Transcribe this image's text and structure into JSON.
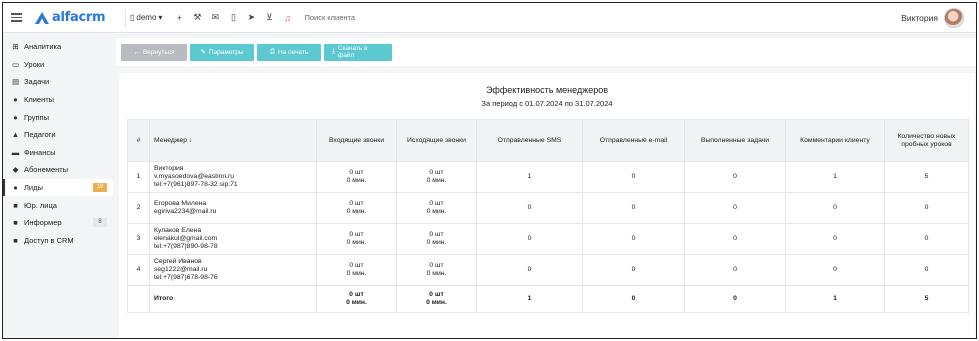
{
  "topbar": {
    "logo_text": "alfacrm",
    "demo_label": "demo",
    "search_placeholder": "Поиск клиента",
    "user_name": "Виктория"
  },
  "sidebar": {
    "items": [
      {
        "label": "Аналитика",
        "icon": "analytics-icon",
        "glyph": "⊞"
      },
      {
        "label": "Уроки",
        "icon": "calendar-icon",
        "glyph": "▭"
      },
      {
        "label": "Задачи",
        "icon": "tasks-icon",
        "glyph": "▤"
      },
      {
        "label": "Клиенты",
        "icon": "user-icon",
        "glyph": "●"
      },
      {
        "label": "Группы",
        "icon": "users-icon",
        "glyph": "●"
      },
      {
        "label": "Педагоги",
        "icon": "graduation-icon",
        "glyph": "▲"
      },
      {
        "label": "Финансы",
        "icon": "money-icon",
        "glyph": "▬"
      },
      {
        "label": "Абонементы",
        "icon": "tag-icon",
        "glyph": "◆"
      },
      {
        "label": "Лиды",
        "icon": "leads-icon",
        "glyph": "●",
        "badge": "19",
        "active": true
      },
      {
        "label": "Юр. лица",
        "icon": "briefcase-icon",
        "glyph": "■"
      },
      {
        "label": "Информер",
        "icon": "informer-icon",
        "glyph": "■",
        "badge": "8"
      },
      {
        "label": "Доступ в CRM",
        "icon": "lock-icon",
        "glyph": "■"
      }
    ]
  },
  "toolbar": {
    "back_label": "Вернуться",
    "params_label": "Параметры",
    "print_label": "На печать",
    "download_label": "Скачать в файл"
  },
  "report": {
    "title": "Эффективность менеджеров",
    "period": "За период с 01.07.2024 по 31.07.2024",
    "columns": [
      "#",
      "Менеджер ↓",
      "Входящие звонки",
      "Исходящие звонки",
      "Отправленные SMS",
      "Отправленные e-mail",
      "Выполненные задачи",
      "Комментарии клиенту",
      "Количество новых пробных уроков"
    ],
    "rows": [
      {
        "n": "1",
        "name": "Виктория",
        "email": "v.myasoedova@eastinn.ru",
        "phone": "tel:+7(961)897-78-32  sip:71",
        "in_calls": "0 шт",
        "in_min": "0 мин.",
        "out_calls": "0 шт",
        "out_min": "0 мин.",
        "sms": "1",
        "email_count": "0",
        "tasks": "0",
        "comments": "1",
        "trials": "5"
      },
      {
        "n": "2",
        "name": "Егорова Милена",
        "email": "egiriva2234@mail.ru",
        "phone": "",
        "in_calls": "0 шт",
        "in_min": "0 мин.",
        "out_calls": "0 шт",
        "out_min": "0 мин.",
        "sms": "0",
        "email_count": "0",
        "tasks": "0",
        "comments": "0",
        "trials": "0"
      },
      {
        "n": "3",
        "name": "Кулаков Елена",
        "email": "elenakul@gmail.com",
        "phone": "tel:+7(987)890-98-78",
        "in_calls": "0 шт",
        "in_min": "0 мин.",
        "out_calls": "0 шт",
        "out_min": "0 мин.",
        "sms": "0",
        "email_count": "0",
        "tasks": "0",
        "comments": "0",
        "trials": "0"
      },
      {
        "n": "4",
        "name": "Сергей Иванов",
        "email": "seg1222@mail.ru",
        "phone": "tel:+7(987)678-98-76",
        "in_calls": "0 шт",
        "in_min": "0 мин.",
        "out_calls": "0 шт",
        "out_min": "0 мин.",
        "sms": "0",
        "email_count": "0",
        "tasks": "0",
        "comments": "0",
        "trials": "0"
      }
    ],
    "total": {
      "label": "Итого",
      "in_calls": "0 шт",
      "in_min": "0 мин.",
      "out_calls": "0 шт",
      "out_min": "0 мин.",
      "sms": "1",
      "email_count": "0",
      "tasks": "0",
      "comments": "1",
      "trials": "5"
    }
  },
  "colors": {
    "accent": "#2a7ad6",
    "teal": "#5bc9cf",
    "badge_orange": "#f0ad4e",
    "notify_red": "#e35454"
  }
}
